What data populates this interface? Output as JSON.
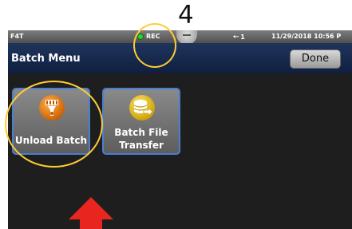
{
  "callout": {
    "number": "4"
  },
  "status_bar": {
    "model": "F4T",
    "rec_label": "REC",
    "usb_count": "1",
    "datetime": "11/29/2018 10:56 P"
  },
  "header": {
    "title": "Batch Menu",
    "done_label": "Done"
  },
  "tiles": [
    {
      "label": "Unload Batch",
      "icon": "unload-icon"
    },
    {
      "label_line1": "Batch File",
      "label_line2": "Transfer",
      "icon": "batch-file-transfer-icon"
    }
  ],
  "colors": {
    "highlight": "#ffcc33",
    "arrow": "#e8261f",
    "title_bar": "#1a2d52",
    "tile_border": "#4a7fd1",
    "icon_orange": "#e07a10",
    "icon_yellow": "#f2c400"
  }
}
